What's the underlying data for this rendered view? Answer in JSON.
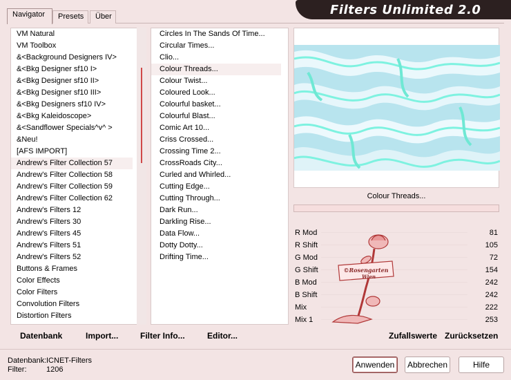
{
  "app": {
    "title": "Filters Unlimited 2.0"
  },
  "tabs": [
    "Navigator",
    "Presets",
    "Über"
  ],
  "categories": [
    "VM Natural",
    "VM Toolbox",
    "&<Background Designers IV>",
    "&<Bkg Designer sf10 I>",
    "&<Bkg Designer sf10 II>",
    "&<Bkg Designer sf10 III>",
    "&<Bkg Designers sf10 IV>",
    "&<Bkg Kaleidoscope>",
    "&<Sandflower Specials^v^ >",
    "&Neu!",
    "[AFS IMPORT]",
    "Andrew's Filter Collection 57",
    "Andrew's Filter Collection 58",
    "Andrew's Filter Collection 59",
    "Andrew's Filter Collection 62",
    "Andrew's Filters 12",
    "Andrew's Filters 30",
    "Andrew's Filters 45",
    "Andrew's Filters 51",
    "Andrew's Filters 52",
    "Buttons & Frames",
    "Color Effects",
    "Color Filters",
    "Convolution Filters",
    "Distortion Filters",
    "Edges"
  ],
  "filters": [
    "Circles In The Sands Of Time...",
    "Circular Times...",
    "Clio...",
    "Colour Threads...",
    "Colour Twist...",
    "Coloured Look...",
    "Colourful basket...",
    "Colourful Blast...",
    "Comic Art 10...",
    "Criss Crossed...",
    "Crossing Time 2...",
    "CrossRoads City...",
    "Curled and Whirled...",
    "Cutting Edge...",
    "Cutting Through...",
    "Dark Run...",
    "Darkling Rise...",
    "Data Flow...",
    "Dotty Dotty...",
    "Drifting Time..."
  ],
  "selected_category_index": 11,
  "selected_filter_index": 3,
  "preview": {
    "filter_name": "Colour Threads..."
  },
  "params": [
    {
      "label": "R Mod",
      "value": "81"
    },
    {
      "label": "R Shift",
      "value": "105"
    },
    {
      "label": "G Mod",
      "value": "72"
    },
    {
      "label": "G Shift",
      "value": "154"
    },
    {
      "label": "B Mod",
      "value": "242"
    },
    {
      "label": "B Shift",
      "value": "242"
    },
    {
      "label": "Mix",
      "value": "222"
    },
    {
      "label": "Mix 1",
      "value": "253"
    }
  ],
  "watermark": {
    "text": "©Rosengarten Wien"
  },
  "toolbar": {
    "database": "Datenbank",
    "import": "Import...",
    "filter_info": "Filter Info...",
    "editor": "Editor...",
    "random": "Zufallswerte",
    "reset": "Zurücksetzen"
  },
  "status": {
    "database_label": "Datenbank:",
    "database_value": "ICNET-Filters",
    "filter_label": "Filter:",
    "filter_value": "1206"
  },
  "buttons": {
    "apply": "Anwenden",
    "cancel": "Abbrechen",
    "help": "Hilfe"
  },
  "colors": {
    "banner": "#2c2020",
    "background": "#f3e4e4",
    "scroll_thumb": "#d04848",
    "preview_cyan": "#7ef2e0"
  }
}
